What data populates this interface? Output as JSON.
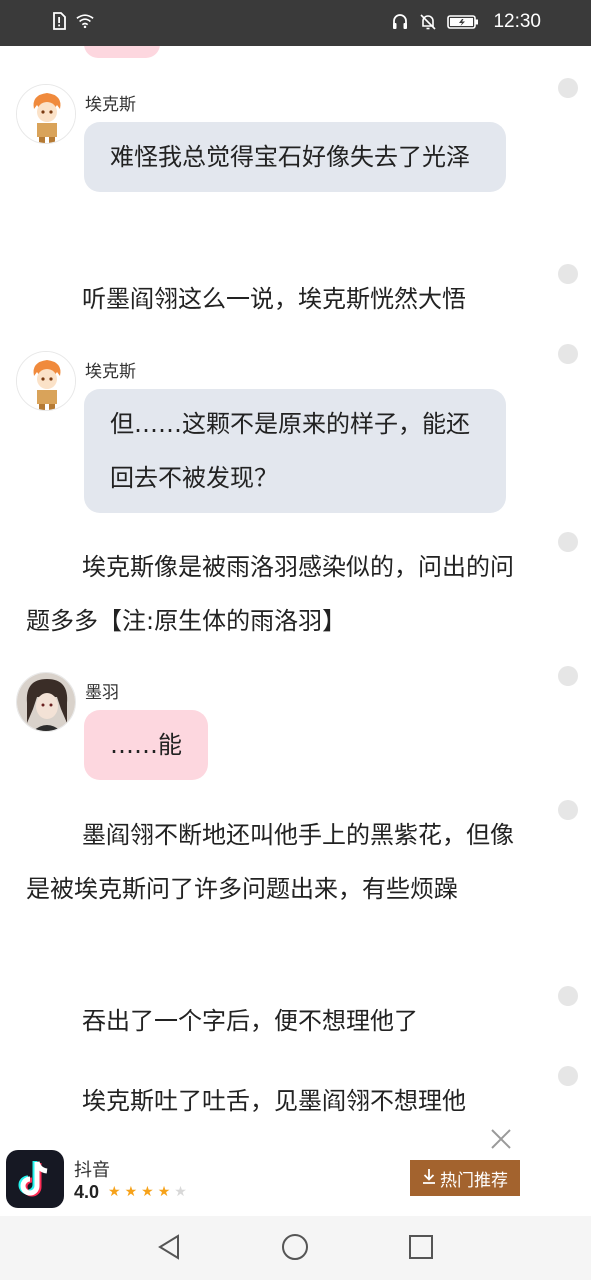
{
  "statusbar": {
    "left_icons": [
      "sim-alert-icon",
      "wifi-icon"
    ],
    "right_icons": [
      "headset-icon",
      "bell-off-icon",
      "battery-charging-icon"
    ],
    "time": "12:30"
  },
  "chat": {
    "messages": [
      {
        "type": "bubble",
        "speaker": "埃克斯",
        "avatar": "exe-avatar",
        "text": "难怪我总觉得宝石好像失去了光泽",
        "color": "#e3e7ee"
      },
      {
        "type": "narration",
        "text": "听墨阎翎这么一说，埃克斯恍然大悟"
      },
      {
        "type": "bubble",
        "speaker": "埃克斯",
        "avatar": "exe-avatar",
        "text": "但……这颗不是原来的样子，能还回去不被发现？",
        "color": "#e3e7ee"
      },
      {
        "type": "narration",
        "text": "埃克斯像是被雨洛羽感染似的，问出的问题多多【注:原生体的雨洛羽】"
      },
      {
        "type": "bubble",
        "speaker": "墨羽",
        "avatar": "moyu-avatar",
        "text": "……能",
        "color": "#fdd7df"
      },
      {
        "type": "narration",
        "text": "墨阎翎不断地还叫他手上的黑紫花，但像是被埃克斯问了许多问题出来，有些烦躁"
      },
      {
        "type": "narration",
        "text": "吞出了一个字后，便不想理他了"
      },
      {
        "type": "narration",
        "text": "埃克斯吐了吐舌，见墨阎翎不想理他"
      }
    ]
  },
  "ad": {
    "app_name": "抖音",
    "rating": "4.0",
    "stars_filled": 4,
    "stars_total": 5,
    "button_label": "热门推荐",
    "button_color": "#a3632e"
  },
  "navbar": {
    "buttons": [
      "back-icon",
      "home-icon",
      "recents-icon"
    ]
  }
}
